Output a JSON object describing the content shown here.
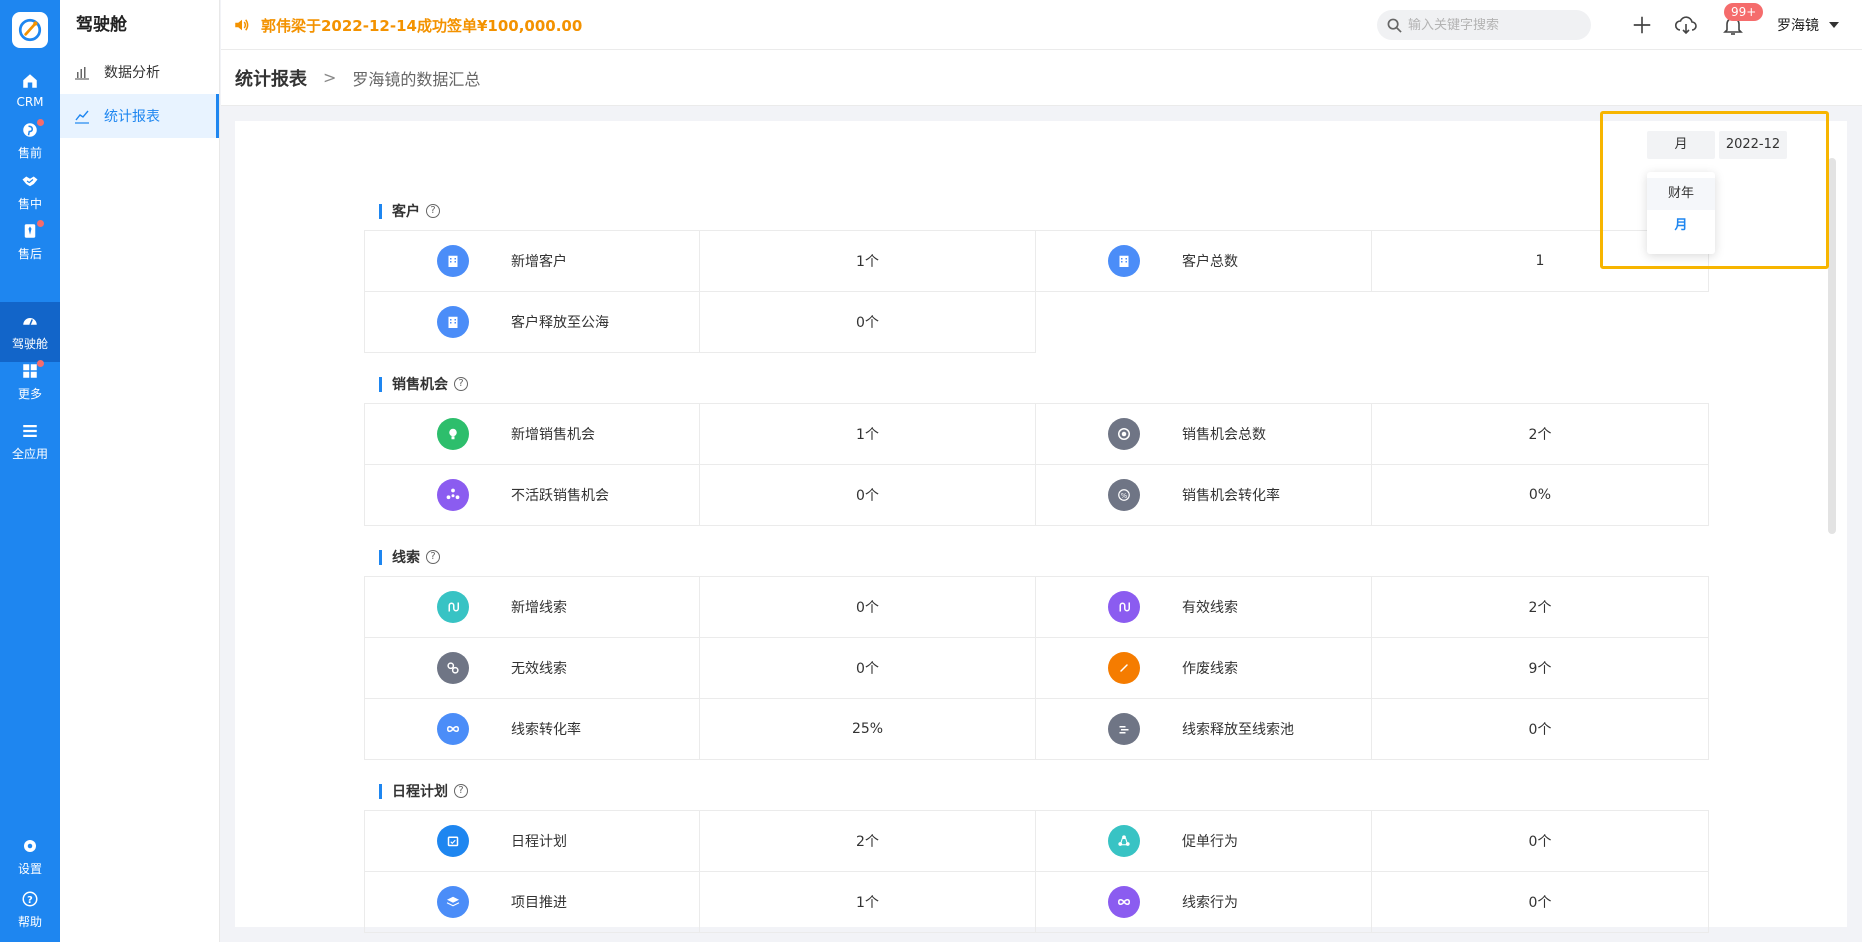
{
  "rail": {
    "items": [
      {
        "label": "CRM"
      },
      {
        "label": "售前"
      },
      {
        "label": "售中"
      },
      {
        "label": "售后"
      },
      {
        "label": "驾驶舱"
      },
      {
        "label": "更多"
      },
      {
        "label": "全应用"
      },
      {
        "label": "设置"
      },
      {
        "label": "帮助"
      }
    ]
  },
  "subnav": {
    "title": "驾驶舱",
    "items": [
      {
        "label": "数据分析"
      },
      {
        "label": "统计报表"
      }
    ]
  },
  "topbar": {
    "announcement": "郭伟梁于2022-12-14成功签单¥100,000.00",
    "search_placeholder": "输入关键字搜索",
    "notification_badge": "99+",
    "user_name": "罗海镜"
  },
  "breadcrumb": {
    "main": "统计报表",
    "sep": ">",
    "sub": "罗海镜的数据汇总"
  },
  "filter": {
    "period": "月",
    "date": "2022-12",
    "options": [
      "财年",
      "月"
    ],
    "selected": "月"
  },
  "colors": {
    "primary": "#1e86f0",
    "announce": "#f39200",
    "highlight": "#f7b500"
  },
  "sections": {
    "customer": {
      "title": "客户",
      "rows": [
        [
          {
            "label": "新增客户",
            "value": "1个"
          },
          {
            "label": "客户总数",
            "value": "1"
          }
        ],
        [
          {
            "label": "客户释放至公海",
            "value": "0个"
          }
        ]
      ]
    },
    "opportunity": {
      "title": "销售机会",
      "rows": [
        [
          {
            "label": "新增销售机会",
            "value": "1个"
          },
          {
            "label": "销售机会总数",
            "value": "2个"
          }
        ],
        [
          {
            "label": "不活跃销售机会",
            "value": "0个"
          },
          {
            "label": "销售机会转化率",
            "value": "0%"
          }
        ]
      ]
    },
    "leads": {
      "title": "线索",
      "rows": [
        [
          {
            "label": "新增线索",
            "value": "0个"
          },
          {
            "label": "有效线索",
            "value": "2个"
          }
        ],
        [
          {
            "label": "无效线索",
            "value": "0个"
          },
          {
            "label": "作废线索",
            "value": "9个"
          }
        ],
        [
          {
            "label": "线索转化率",
            "value": "25%"
          },
          {
            "label": "线索释放至线索池",
            "value": "0个"
          }
        ]
      ]
    },
    "schedule": {
      "title": "日程计划",
      "rows": [
        [
          {
            "label": "日程计划",
            "value": "2个"
          },
          {
            "label": "促单行为",
            "value": "0个"
          }
        ],
        [
          {
            "label": "项目推进",
            "value": "1个"
          },
          {
            "label": "线索行为",
            "value": "0个"
          }
        ]
      ]
    }
  }
}
